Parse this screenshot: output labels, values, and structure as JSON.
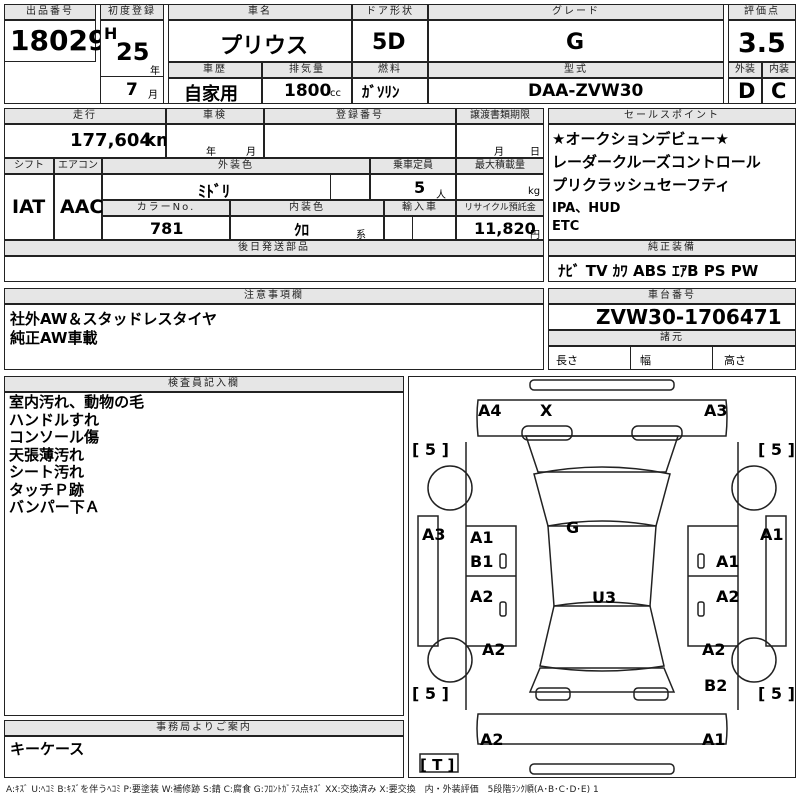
{
  "header": {
    "lot_label": "出品番号",
    "lot_value": "18029",
    "first_reg_label": "初度登録",
    "era": "H",
    "year": "25",
    "year_unit": "年",
    "month": "7",
    "month_unit": "月",
    "model_label": "車名",
    "model_value": "プリウス",
    "doors_label": "ドア形状",
    "doors_value": "5D",
    "grade_label": "グレード",
    "grade_value": "G",
    "score_label": "評価点",
    "score_value": "3.5",
    "exterior_label": "外装",
    "exterior_value": "D",
    "interior_label": "内装",
    "interior_value": "C",
    "history_label": "車歴",
    "history_value": "自家用",
    "displacement_label": "排気量",
    "displacement_value": "1800",
    "displacement_unit": "cc",
    "fuel_label": "燃料",
    "fuel_value": "ｶﾞｿﾘﾝ",
    "type_label": "型式",
    "type_value": "DAA-ZVW30"
  },
  "row2": {
    "mileage_label": "走行",
    "mileage_value": "177,604",
    "mileage_unit": "km",
    "inspection_label": "車検",
    "inspection_year_unit": "年",
    "inspection_month_unit": "月",
    "reg_no_label": "登録番号",
    "transfer_label": "譲渡書類期限",
    "transfer_month_unit": "月",
    "transfer_day_unit": "日",
    "shift_label": "シフト",
    "shift_value": "IAT",
    "ac_label": "エアコン",
    "ac_value": "AAC",
    "color_label": "外装色",
    "color_value": "ﾐﾄﾞﾘ",
    "capacity_label": "乗車定員",
    "capacity_value": "5",
    "capacity_unit": "人",
    "load_label": "最大積載量",
    "load_unit": "kg",
    "color_no_label": "カラーNo.",
    "color_no_value": "781",
    "interior_color_label": "内装色",
    "interior_color_value": "ｸﾛ",
    "interior_color_unit": "系",
    "import_label": "輸入車",
    "recycle_label": "リサイクル預託金",
    "recycle_value": "11,820",
    "recycle_unit": "円",
    "later_parts_label": "後日発送部品"
  },
  "sales_points": {
    "label": "セールスポイント",
    "items": [
      "★オークションデビュー★",
      "レーダークルーズコントロール",
      "プリクラッシュセーフティ",
      "IPA、HUD",
      "ETC"
    ]
  },
  "equipment": {
    "label": "純正装備",
    "value": "ﾅﾋﾞ TV ｶﾜ ABS ｴｱB PS PW"
  },
  "caution": {
    "label": "注意事項欄",
    "lines": [
      "社外AW＆スタッドレスタイヤ",
      "純正AW車載"
    ]
  },
  "chassis": {
    "label": "車台番号",
    "value": "ZVW30-1706471",
    "dims_label": "諸元",
    "length_label": "長さ",
    "width_label": "幅",
    "height_label": "高さ"
  },
  "inspector": {
    "label": "検査員記入欄",
    "items": [
      "室内汚れ、動物の毛",
      "ハンドルすれ",
      "コンソール傷",
      "天張薄汚れ",
      "シート汚れ",
      "タッチＰ跡",
      "バンパー下Ａ"
    ]
  },
  "office": {
    "label": "事務局よりご案内",
    "value": "キーケース"
  },
  "diagram": {
    "a4": "A4",
    "x": "X",
    "a3_top_right": "A3",
    "tire_fl": "[ 5 ]",
    "tire_fr": "[ 5 ]",
    "tire_rl": "[ 5 ]",
    "tire_rr": "[ 5 ]",
    "a3_left": "A3",
    "a1_right_edge": "A1",
    "g": "G",
    "a1_left_door": "A1",
    "b1_left_door": "B1",
    "a1_right_door": "A1",
    "a2_left_rear_door": "A2",
    "u3": "U3",
    "a2_right_rear_door": "A2",
    "a2_left_quarter": "A2",
    "a2_right_quarter": "A2",
    "b2": "B2",
    "a2_bottom_left": "A2",
    "a1_bottom_right": "A1",
    "spare": "[ T ]"
  },
  "legend": "A:ｷｽﾞ U:ﾍｺﾐ B:ｷｽﾞを伴うﾍｺﾐ P:要塗装 W:補修跡 S:錆 C:腐食 G:ﾌﾛﾝﾄｶﾞﾗｽ点ｷｽﾞ XX:交換済み X:要交換　内・外装評価　5段階ﾗﾝｸ順(A･B･C･D･E) 1"
}
